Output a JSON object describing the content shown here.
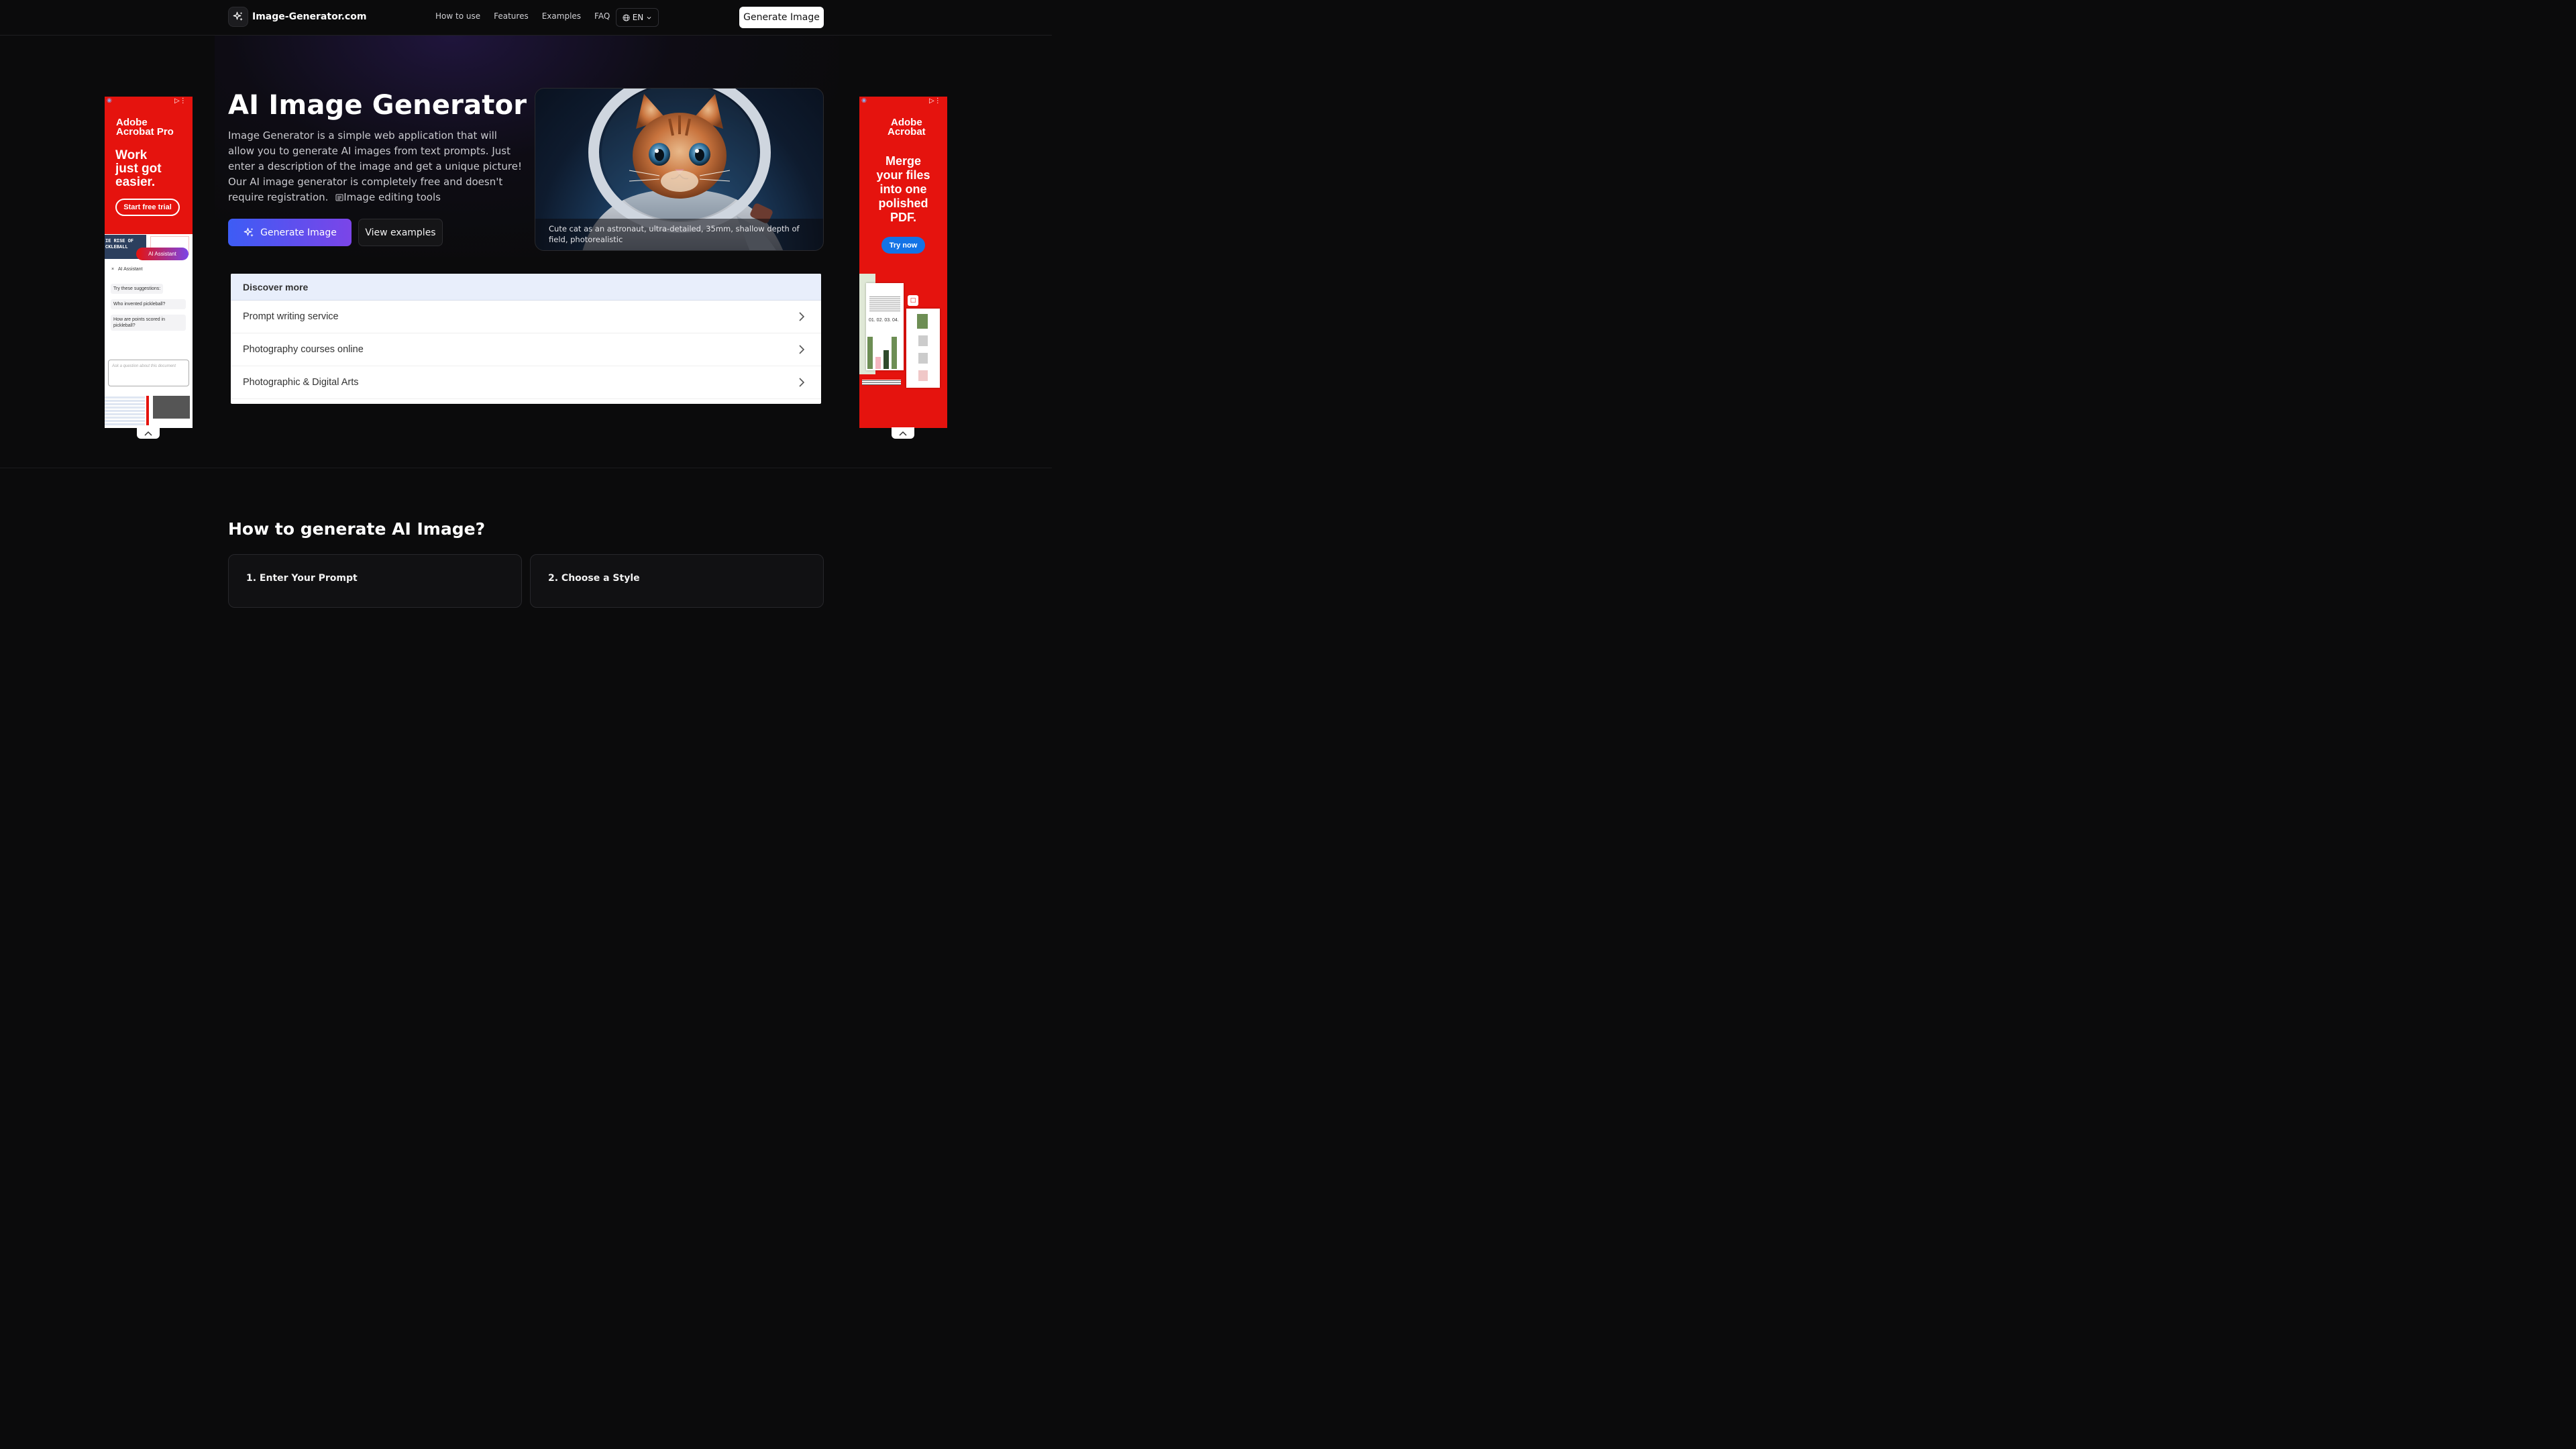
{
  "header": {
    "logo_text": "Image-Generator.com",
    "nav": [
      "How to use",
      "Features",
      "Examples",
      "FAQ"
    ],
    "lang": "EN",
    "cta": "Generate Image"
  },
  "hero": {
    "title": "AI Image Generator",
    "description": "Image Generator is a simple web application that will allow you to generate AI images from text prompts. Just enter a description of the image and get a unique picture! Our AI image generator is completely free and doesn't require registration.",
    "tool_link_a": "Image",
    "tool_link_b": "editing tools",
    "primary_button": "Generate Image",
    "secondary_button": "View examples",
    "image_caption": "Cute cat as an astronaut, ultra-detailed, 35mm, shallow depth of field, photorealistic"
  },
  "discover": {
    "title": "Discover more",
    "items": [
      "Prompt writing service",
      "Photography courses online",
      "Photographic & Digital Arts"
    ]
  },
  "ad_left": {
    "brand_line1": "Adobe",
    "brand_line2": "Acrobat Pro",
    "headline_1": "Work",
    "headline_2": "just got",
    "headline_3": "easier.",
    "cta": "Start free trial",
    "assistant_badge": "AI Assistant",
    "panel_title": "AI Assistant",
    "suggest_title": "Try these suggestions:",
    "suggest_1": "Who invented pickleball?",
    "suggest_2": "How are points scored in pickleball?",
    "input_placeholder": "Ask a question about this document",
    "article_title_1": "IE RISE OF",
    "article_title_2": "CKLEBALL"
  },
  "ad_right": {
    "brand_line1": "Adobe",
    "brand_line2": "Acrobat",
    "headline_1": "Merge",
    "headline_2": "your files",
    "headline_3": "into one",
    "headline_4": "polished",
    "headline_5": "PDF.",
    "cta": "Try now",
    "doc_label": "01. 02. 03. 04."
  },
  "how_to": {
    "title": "How to generate AI Image?",
    "steps": [
      "1. Enter Your Prompt",
      "2. Choose a Style"
    ]
  },
  "colors": {
    "background": "#0b0b0c",
    "gradient_start": "#3d5cf5",
    "gradient_end": "#7b45e8",
    "ad_red": "#e5130e"
  }
}
